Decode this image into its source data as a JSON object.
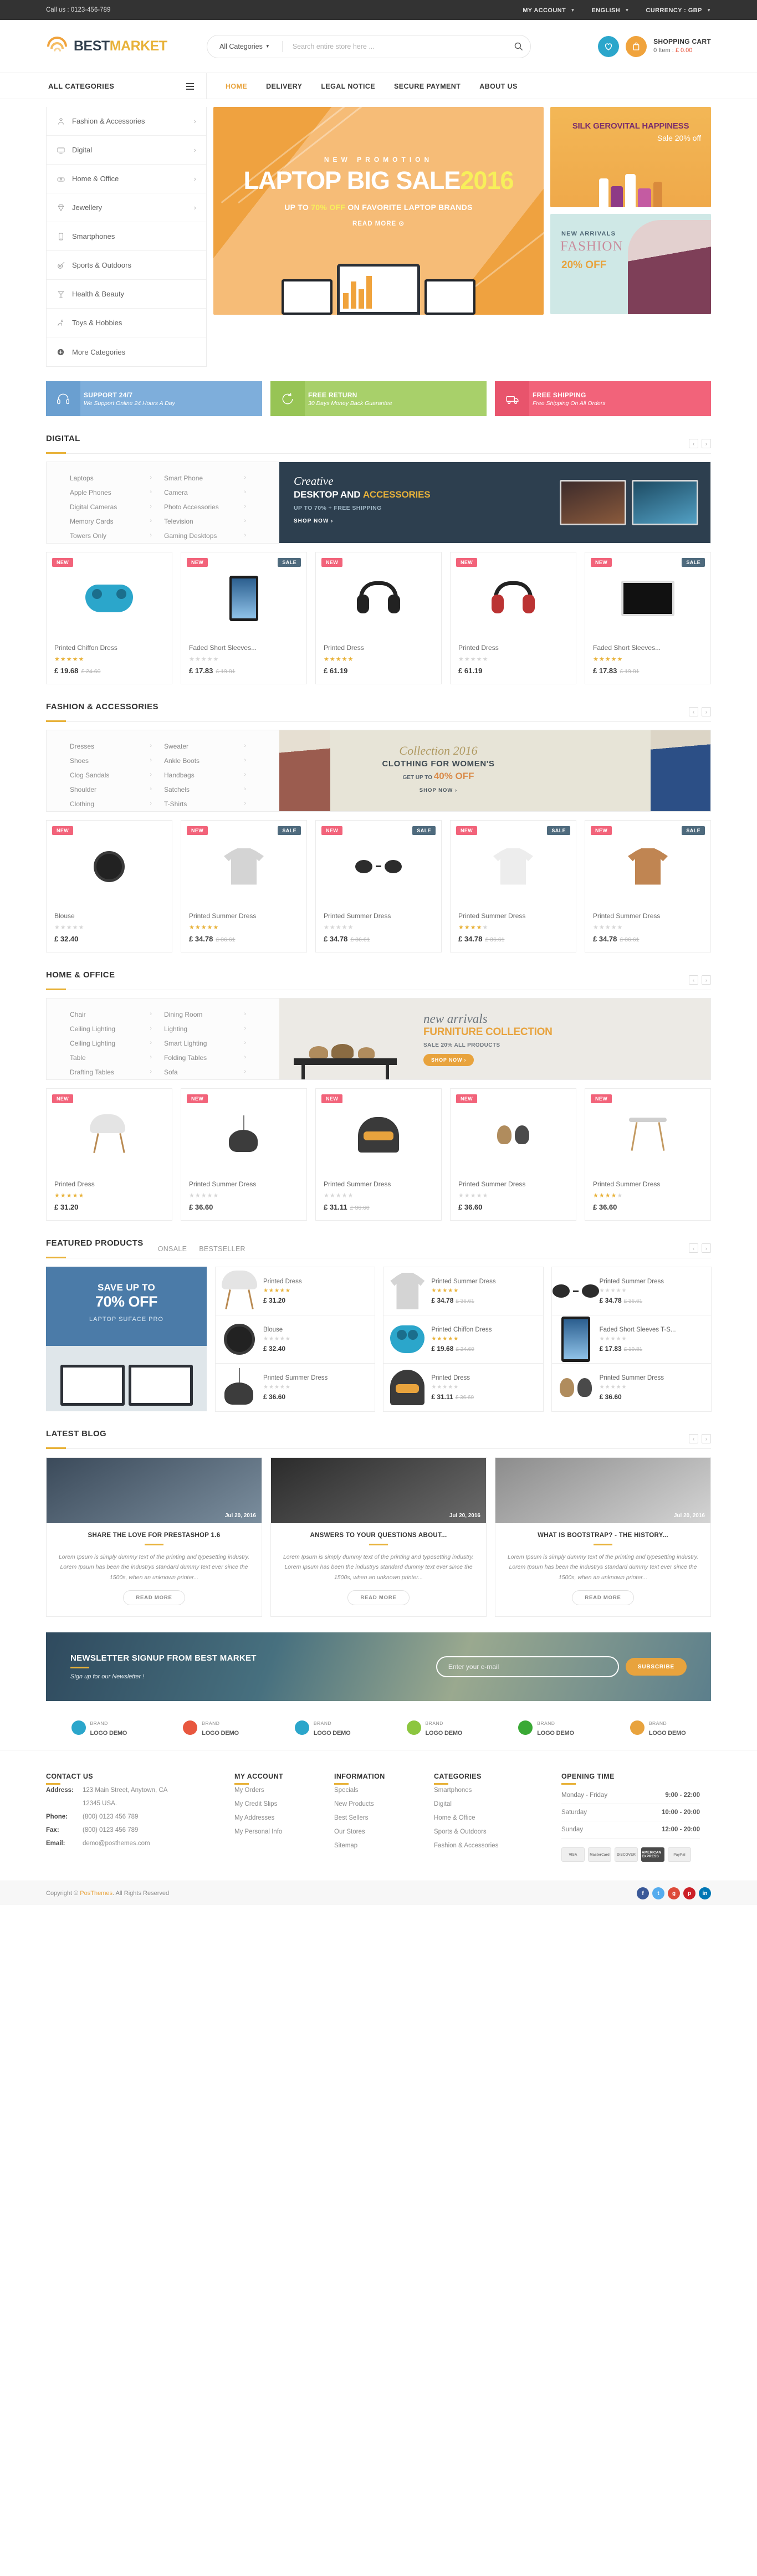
{
  "topbar": {
    "callus": "Call us : 0123-456-789",
    "account": "MY ACCOUNT",
    "language": "ENGLISH",
    "currency": "CURRENCY : GBP"
  },
  "header": {
    "logo_best": "BEST",
    "logo_market": "MARKET",
    "search_category": "All Categories",
    "search_placeholder": "Search entire store here ...",
    "cart_title": "SHOPPING CART",
    "cart_count": "0 Item : ",
    "cart_total": "£ 0.00"
  },
  "nav": {
    "all_categories": "ALL CATEGORIES",
    "menu": [
      {
        "label": "HOME",
        "active": true
      },
      {
        "label": "DELIVERY",
        "active": false
      },
      {
        "label": "LEGAL NOTICE",
        "active": false
      },
      {
        "label": "SECURE PAYMENT",
        "active": false
      },
      {
        "label": "ABOUT US",
        "active": false
      }
    ]
  },
  "sidebar": {
    "items": [
      {
        "label": "Fashion & Accessories",
        "icon": "person-icon",
        "arrow": "›"
      },
      {
        "label": "Digital",
        "icon": "monitor-icon",
        "arrow": "›"
      },
      {
        "label": "Home & Office",
        "icon": "sofa-icon",
        "arrow": "›"
      },
      {
        "label": "Jewellery",
        "icon": "diamond-icon",
        "arrow": "›"
      },
      {
        "label": "Smartphones",
        "icon": "phone-icon",
        "arrow": ""
      },
      {
        "label": "Sports & Outdoors",
        "icon": "target-icon",
        "arrow": ""
      },
      {
        "label": "Health & Beauty",
        "icon": "cocktail-icon",
        "arrow": ""
      },
      {
        "label": "Toys & Hobbies",
        "icon": "toy-icon",
        "arrow": ""
      },
      {
        "label": "More Categories",
        "icon": "plus-circle-icon",
        "arrow": ""
      }
    ]
  },
  "hero": {
    "kicker": "NEW PROMOTION",
    "title_main": "LAPTOP BIG SALE",
    "title_year": "2016",
    "sub_pre": "UP TO ",
    "sub_hl": "70% OFF",
    "sub_post": " ON FAVORITE LAPTOP BRANDS",
    "read_more": "READ MORE ⊙"
  },
  "promos": {
    "silk_title": "SILK GEROVITAL HAPPINESS",
    "silk_sale": "Sale 20% off",
    "fashion_kicker": "NEW ARRIVALS",
    "fashion_title": "FASHION",
    "fashion_off": "20% OFF"
  },
  "services": [
    {
      "title": "SUPPORT 24/7",
      "sub": "We Support Online 24 Hours A Day",
      "icon": "headset-icon",
      "color": "blue"
    },
    {
      "title": "FREE RETURN",
      "sub": "30 Days Money Back Guarantee",
      "icon": "refresh-icon",
      "color": "green"
    },
    {
      "title": "FREE SHIPPING",
      "sub": "Free Shipping On All Orders",
      "icon": "truck-icon",
      "color": "red"
    }
  ],
  "sections": {
    "digital": {
      "title": "DIGITAL",
      "subcats_left": [
        "Laptops",
        "Apple Phones",
        "Digital Cameras",
        "Memory Cards",
        "Towers Only"
      ],
      "subcats_right": [
        "Smart Phone",
        "Camera",
        "Photo Accessories",
        "Television",
        "Gaming Desktops"
      ],
      "banner": {
        "script": "Creative",
        "head_a": "DESKTOP AND ",
        "head_b": "ACCESSORIES",
        "small": "UP TO 70% + FREE SHIPPING",
        "button": "SHOP NOW ›"
      },
      "products": [
        {
          "name": "Printed Chiffon Dress",
          "price": "£ 19.68",
          "old": "£ 24.60",
          "stars": 5,
          "badges": [
            "NEW"
          ],
          "ill": "gamepad"
        },
        {
          "name": "Faded Short Sleeves...",
          "price": "£ 17.83",
          "old": "£ 19.81",
          "stars": 0,
          "badges": [
            "NEW",
            "SALE"
          ],
          "ill": "tablet"
        },
        {
          "name": "Printed Dress",
          "price": "£ 61.19",
          "old": "",
          "stars": 5,
          "badges": [
            "NEW"
          ],
          "ill": "headphone-black"
        },
        {
          "name": "Printed Dress",
          "price": "£ 61.19",
          "old": "",
          "stars": 0,
          "badges": [
            "NEW"
          ],
          "ill": "headphone-red"
        },
        {
          "name": "Faded Short Sleeves...",
          "price": "£ 17.83",
          "old": "£ 19.81",
          "stars": 5,
          "badges": [
            "NEW",
            "SALE"
          ],
          "ill": "monitor"
        }
      ]
    },
    "fashion": {
      "title": "FASHION & ACCESSORIES",
      "subcats_left": [
        "Dresses",
        "Shoes",
        "Clog Sandals",
        "Shoulder",
        "Clothing"
      ],
      "subcats_right": [
        "Sweater",
        "Ankle Boots",
        "Handbags",
        "Satchels",
        "T-Shirts"
      ],
      "banner": {
        "c1": "Collection 2016",
        "c2": "CLOTHING FOR WOMEN'S",
        "c3_pre": "GET UP TO ",
        "c3": "40% OFF",
        "c4": "SHOP NOW ›"
      },
      "products": [
        {
          "name": "Blouse",
          "price": "£ 32.40",
          "old": "",
          "stars": 0,
          "badges": [
            "NEW"
          ],
          "ill": "watch"
        },
        {
          "name": "Printed Summer Dress",
          "price": "£ 34.78",
          "old": "£ 36.61",
          "stars": 5,
          "badges": [
            "NEW",
            "SALE"
          ],
          "ill": "tshirt"
        },
        {
          "name": "Printed Summer Dress",
          "price": "£ 34.78",
          "old": "£ 36.61",
          "stars": 0,
          "badges": [
            "NEW",
            "SALE"
          ],
          "ill": "glasses"
        },
        {
          "name": "Printed Summer Dress",
          "price": "£ 34.78",
          "old": "£ 36.61",
          "stars": 4,
          "badges": [
            "NEW",
            "SALE"
          ],
          "ill": "tshirt-white"
        },
        {
          "name": "Printed Summer Dress",
          "price": "£ 34.78",
          "old": "£ 36.61",
          "stars": 0,
          "badges": [
            "NEW",
            "SALE"
          ],
          "ill": "shirt"
        }
      ]
    },
    "home": {
      "title": "HOME & OFFICE",
      "subcats_left": [
        "Chair",
        "Ceiling Lighting",
        "Ceiling Lighting",
        "Table",
        "Drafting Tables"
      ],
      "subcats_right": [
        "Dining Room",
        "Lighting",
        "Smart Lighting",
        "Folding Tables",
        "Sofa"
      ],
      "banner": {
        "n1": "new arrivals",
        "n2": "FURNITURE COLLECTION",
        "n3": "SALE 20% ALL PRODUCTS",
        "n4": "SHOP NOW ›"
      },
      "products": [
        {
          "name": "Printed Dress",
          "price": "£ 31.20",
          "old": "",
          "stars": 5,
          "badges": [
            "NEW"
          ],
          "ill": "chair"
        },
        {
          "name": "Printed Summer Dress",
          "price": "£ 36.60",
          "old": "",
          "stars": 0,
          "badges": [
            "NEW"
          ],
          "ill": "lamp"
        },
        {
          "name": "Printed Summer Dress",
          "price": "£ 31.11",
          "old": "£ 36.60",
          "stars": 0,
          "badges": [
            "NEW"
          ],
          "ill": "armchair"
        },
        {
          "name": "Printed Summer Dress",
          "price": "£ 36.60",
          "old": "",
          "stars": 0,
          "badges": [
            "NEW"
          ],
          "ill": "birds"
        },
        {
          "name": "Printed Summer Dress",
          "price": "£ 36.60",
          "old": "",
          "stars": 4,
          "badges": [
            "NEW"
          ],
          "ill": "stool"
        }
      ]
    },
    "featured": {
      "title": "FEATURED PRODUCTS",
      "tabs": [
        "ONSALE",
        "BESTSELLER"
      ],
      "promo": {
        "t1": "SAVE UP TO",
        "t2": "70% OFF",
        "t3": "LAPTOP SUFACE PRO"
      },
      "items": [
        {
          "name": "Printed Dress",
          "price": "£ 31.20",
          "old": "",
          "stars": 5,
          "ill": "chair"
        },
        {
          "name": "Printed Summer Dress",
          "price": "£ 34.78",
          "old": "£ 36.61",
          "stars": 5,
          "ill": "tshirt"
        },
        {
          "name": "Printed Summer Dress",
          "price": "£ 34.78",
          "old": "£ 36.61",
          "stars": 0,
          "ill": "glasses"
        },
        {
          "name": "Blouse",
          "price": "£ 32.40",
          "old": "",
          "stars": 0,
          "ill": "watch"
        },
        {
          "name": "Printed Chiffon Dress",
          "price": "£ 19.68",
          "old": "£ 24.60",
          "stars": 5,
          "ill": "gamepad"
        },
        {
          "name": "Faded Short Sleeves T-S...",
          "price": "£ 17.83",
          "old": "£ 19.81",
          "stars": 0,
          "ill": "tablet"
        },
        {
          "name": "Printed Summer Dress",
          "price": "£ 36.60",
          "old": "",
          "stars": 0,
          "ill": "lamp"
        },
        {
          "name": "Printed Dress",
          "price": "£ 31.11",
          "old": "£ 36.60",
          "stars": 0,
          "ill": "armchair"
        },
        {
          "name": "Printed Summer Dress",
          "price": "£ 36.60",
          "old": "",
          "stars": 0,
          "ill": "birds"
        }
      ]
    },
    "blog": {
      "title": "LATEST BLOG",
      "posts": [
        {
          "date": "Jul 20, 2016",
          "title": "SHARE THE LOVE FOR PRESTASHOP 1.6",
          "excerpt": "Lorem Ipsum is simply dummy text of the printing and typesetting industry. Lorem Ipsum has been the industrys standard dummy text ever since the 1500s, when an unknown printer...",
          "read_more": "READ MORE"
        },
        {
          "date": "Jul 20, 2016",
          "title": "ANSWERS TO YOUR QUESTIONS ABOUT...",
          "excerpt": "Lorem Ipsum is simply dummy text of the printing and typesetting industry. Lorem Ipsum has been the industrys standard dummy text ever since the 1500s, when an unknown printer...",
          "read_more": "READ MORE"
        },
        {
          "date": "Jul 20, 2016",
          "title": "WHAT IS BOOTSTRAP? - THE HISTORY...",
          "excerpt": "Lorem Ipsum is simply dummy text of the printing and typesetting industry. Lorem Ipsum has been the industrys standard dummy text ever since the 1500s, when an unknown printer...",
          "read_more": "READ MORE"
        }
      ]
    }
  },
  "newsletter": {
    "title": "NEWSLETTER SIGNUP FROM BEST MARKET",
    "sub": "Sign up for our Newsletter !",
    "placeholder": "Enter your e-mail",
    "button": "SUBSCRIBE"
  },
  "brands": [
    {
      "t1": "BRAND",
      "t2": "LOGO DEMO",
      "color": "#2ba6cb"
    },
    {
      "t1": "BRAND",
      "t2": "LOGO DEMO",
      "color": "#e8573f"
    },
    {
      "t1": "BRAND",
      "t2": "LOGO DEMO",
      "color": "#2ba6cb"
    },
    {
      "t1": "BRAND",
      "t2": "LOGO DEMO",
      "color": "#8cc63f"
    },
    {
      "t1": "BRAND",
      "t2": "LOGO DEMO",
      "color": "#3aa935"
    },
    {
      "t1": "BRAND",
      "t2": "LOGO DEMO",
      "color": "#e8a33d"
    }
  ],
  "footer": {
    "contact": {
      "title": "CONTACT US",
      "rows": [
        {
          "label": "Address:",
          "value": "123 Main Street, Anytown, CA"
        },
        {
          "label": "",
          "value": "12345 USA."
        },
        {
          "label": "Phone:",
          "value": "(800) 0123 456 789"
        },
        {
          "label": "Fax:",
          "value": "(800) 0123 456 789"
        },
        {
          "label": "Email:",
          "value": "demo@posthemes.com"
        }
      ]
    },
    "account": {
      "title": "MY ACCOUNT",
      "links": [
        "My Orders",
        "My Credit Slips",
        "My Addresses",
        "My Personal Info"
      ]
    },
    "information": {
      "title": "INFORMATION",
      "links": [
        "Specials",
        "New Products",
        "Best Sellers",
        "Our Stores",
        "Sitemap"
      ]
    },
    "categories": {
      "title": "CATEGORIES",
      "links": [
        "Smartphones",
        "Digital",
        "Home & Office",
        "Sports & Outdoors",
        "Fashion & Accessories"
      ]
    },
    "opening": {
      "title": "OPENING TIME",
      "rows": [
        {
          "day": "Monday - Friday",
          "hours": "9:00 - 22:00"
        },
        {
          "day": "Saturday",
          "hours": "10:00 - 20:00"
        },
        {
          "day": "Sunday",
          "hours": "12:00 - 20:00"
        }
      ],
      "payments": [
        "VISA",
        "MasterCard",
        "DISCOVER",
        "AMERICAN EXPRESS",
        "PayPal"
      ]
    },
    "copyright_pre": "Copyright © ",
    "copyright_brand": "PosThemes",
    "copyright_post": ". All Rights Reserved",
    "socials": [
      "f",
      "t",
      "g",
      "p",
      "in"
    ]
  }
}
